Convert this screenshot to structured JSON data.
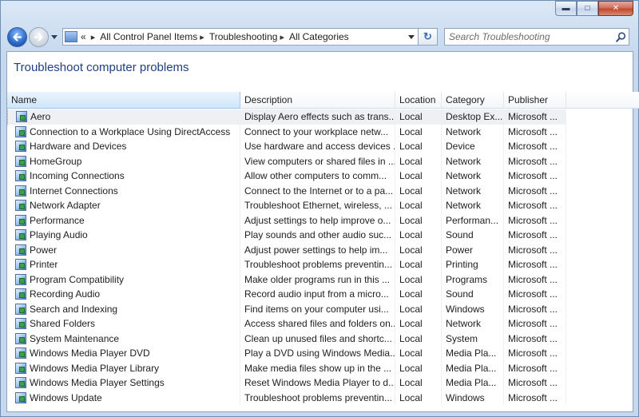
{
  "window": {
    "controls": {
      "minimize": "▬",
      "maximize": "□",
      "close": "✕"
    }
  },
  "nav": {
    "back_icon": "back-arrow-icon",
    "forward_icon": "forward-arrow-icon",
    "address_prefix": "«",
    "breadcrumbs": [
      "All Control Panel Items",
      "Troubleshooting",
      "All Categories"
    ],
    "breadcrumb_separator": "▸",
    "refresh_label": "↻",
    "search_placeholder": "Search Troubleshooting"
  },
  "page": {
    "title": "Troubleshoot computer problems"
  },
  "table": {
    "columns": [
      "Name",
      "Description",
      "Location",
      "Category",
      "Publisher"
    ],
    "sorted_column": "Name",
    "rows": [
      {
        "name": "Aero",
        "description": "Display Aero effects such as trans...",
        "location": "Local",
        "category": "Desktop Ex...",
        "publisher": "Microsoft ..."
      },
      {
        "name": "Connection to a Workplace Using DirectAccess",
        "description": "Connect to your workplace netw...",
        "location": "Local",
        "category": "Network",
        "publisher": "Microsoft ..."
      },
      {
        "name": "Hardware and Devices",
        "description": "Use hardware and access devices ...",
        "location": "Local",
        "category": "Device",
        "publisher": "Microsoft ..."
      },
      {
        "name": "HomeGroup",
        "description": "View computers or shared files in ...",
        "location": "Local",
        "category": "Network",
        "publisher": "Microsoft ..."
      },
      {
        "name": "Incoming Connections",
        "description": "Allow other computers to comm...",
        "location": "Local",
        "category": "Network",
        "publisher": "Microsoft ..."
      },
      {
        "name": "Internet Connections",
        "description": "Connect to the Internet or to a pa...",
        "location": "Local",
        "category": "Network",
        "publisher": "Microsoft ..."
      },
      {
        "name": "Network Adapter",
        "description": "Troubleshoot Ethernet, wireless, ...",
        "location": "Local",
        "category": "Network",
        "publisher": "Microsoft ..."
      },
      {
        "name": "Performance",
        "description": "Adjust settings to help improve o...",
        "location": "Local",
        "category": "Performan...",
        "publisher": "Microsoft ..."
      },
      {
        "name": "Playing Audio",
        "description": "Play sounds and other audio suc...",
        "location": "Local",
        "category": "Sound",
        "publisher": "Microsoft ..."
      },
      {
        "name": "Power",
        "description": "Adjust power settings to help im...",
        "location": "Local",
        "category": "Power",
        "publisher": "Microsoft ..."
      },
      {
        "name": "Printer",
        "description": "Troubleshoot problems preventin...",
        "location": "Local",
        "category": "Printing",
        "publisher": "Microsoft ..."
      },
      {
        "name": "Program Compatibility",
        "description": "Make older programs run in this ...",
        "location": "Local",
        "category": "Programs",
        "publisher": "Microsoft ..."
      },
      {
        "name": "Recording Audio",
        "description": "Record audio input from a micro...",
        "location": "Local",
        "category": "Sound",
        "publisher": "Microsoft ..."
      },
      {
        "name": "Search and Indexing",
        "description": "Find items on your computer usi...",
        "location": "Local",
        "category": "Windows",
        "publisher": "Microsoft ..."
      },
      {
        "name": "Shared Folders",
        "description": "Access shared files and folders on...",
        "location": "Local",
        "category": "Network",
        "publisher": "Microsoft ..."
      },
      {
        "name": "System Maintenance",
        "description": "Clean up unused files and shortc...",
        "location": "Local",
        "category": "System",
        "publisher": "Microsoft ..."
      },
      {
        "name": "Windows Media Player DVD",
        "description": "Play a DVD using Windows Media...",
        "location": "Local",
        "category": "Media Pla...",
        "publisher": "Microsoft ..."
      },
      {
        "name": "Windows Media Player Library",
        "description": "Make media files show up in the ...",
        "location": "Local",
        "category": "Media Pla...",
        "publisher": "Microsoft ..."
      },
      {
        "name": "Windows Media Player Settings",
        "description": "Reset Windows Media Player to d...",
        "location": "Local",
        "category": "Media Pla...",
        "publisher": "Microsoft ..."
      },
      {
        "name": "Windows Update",
        "description": "Troubleshoot problems preventin...",
        "location": "Local",
        "category": "Windows",
        "publisher": "Microsoft ..."
      }
    ],
    "selected_row": 0
  },
  "colors": {
    "title_text": "#1e3f83",
    "window_frame": "#c5d8ee",
    "close_button": "#c3472c"
  }
}
